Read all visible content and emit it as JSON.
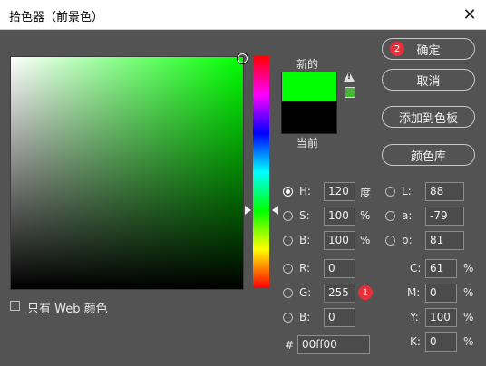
{
  "window": {
    "title": "拾色器（前景色）"
  },
  "swatch": {
    "new_label": "新的",
    "current_label": "当前",
    "new_color": "#00ff00",
    "current_color": "#000000"
  },
  "buttons": {
    "ok": "确定",
    "cancel": "取消",
    "add_to_swatches": "添加到色板",
    "color_libraries": "颜色库"
  },
  "badges": {
    "one": "1",
    "two": "2"
  },
  "hsb": {
    "h_label": "H:",
    "h_value": "120",
    "h_unit": "度",
    "s_label": "S:",
    "s_value": "100",
    "s_unit": "%",
    "b_label": "B:",
    "b_value": "100",
    "b_unit": "%"
  },
  "rgb": {
    "r_label": "R:",
    "r_value": "0",
    "g_label": "G:",
    "g_value": "255",
    "b_label": "B:",
    "b_value": "0"
  },
  "lab": {
    "l_label": "L:",
    "l_value": "88",
    "a_label": "a:",
    "a_value": "-79",
    "b_label": "b:",
    "b_value": "81"
  },
  "cmyk": {
    "c_label": "C:",
    "c_value": "61",
    "m_label": "M:",
    "m_value": "0",
    "y_label": "Y:",
    "y_value": "100",
    "k_label": "K:",
    "k_value": "0",
    "unit": "%"
  },
  "hex": {
    "label": "#",
    "value": "00ff00"
  },
  "web_only": {
    "label": "只有 Web 颜色",
    "checked": false
  },
  "selected_mode": "H"
}
